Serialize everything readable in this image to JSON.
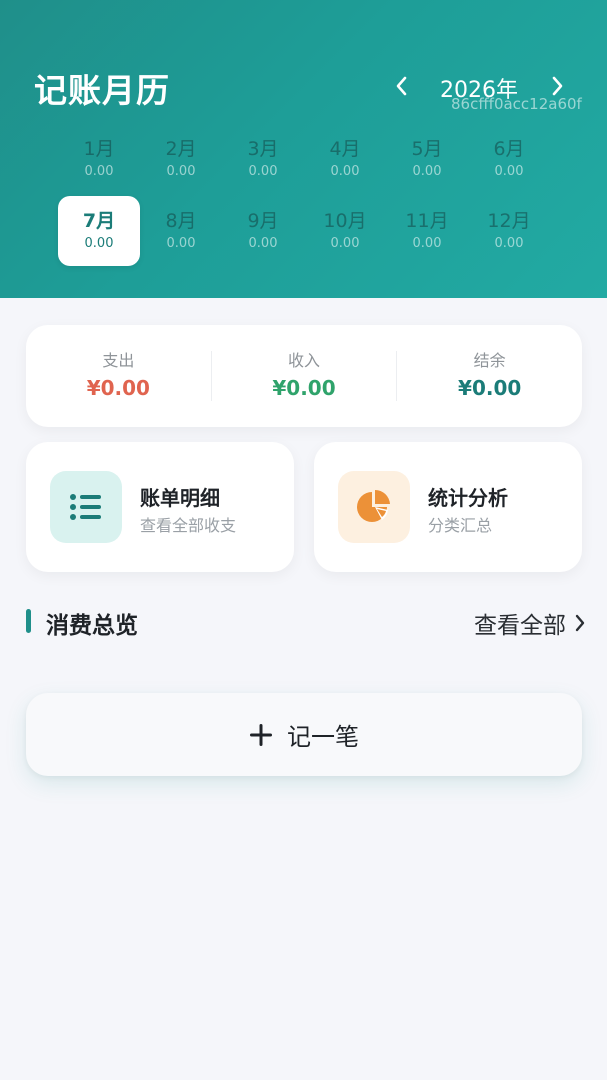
{
  "header": {
    "title": "记账月历",
    "year": "2026年",
    "hash": "86cfff0acc12a60f"
  },
  "months": [
    {
      "name": "1月",
      "amount": "0.00"
    },
    {
      "name": "2月",
      "amount": "0.00"
    },
    {
      "name": "3月",
      "amount": "0.00"
    },
    {
      "name": "4月",
      "amount": "0.00"
    },
    {
      "name": "5月",
      "amount": "0.00"
    },
    {
      "name": "6月",
      "amount": "0.00"
    },
    {
      "name": "7月",
      "amount": "0.00"
    },
    {
      "name": "8月",
      "amount": "0.00"
    },
    {
      "name": "9月",
      "amount": "0.00"
    },
    {
      "name": "10月",
      "amount": "0.00"
    },
    {
      "name": "11月",
      "amount": "0.00"
    },
    {
      "name": "12月",
      "amount": "0.00"
    }
  ],
  "selected_month": "7月",
  "summary": {
    "expense_label": "支出",
    "expense_value": "¥0.00",
    "income_label": "收入",
    "income_value": "¥0.00",
    "balance_label": "结余",
    "balance_value": "¥0.00"
  },
  "actions": {
    "bills": {
      "title": "账单明细",
      "subtitle": "查看全部收支",
      "icon": "list-icon"
    },
    "stats": {
      "title": "统计分析",
      "subtitle": "分类汇总",
      "icon": "pie-chart-icon"
    }
  },
  "section": {
    "title": "消费总览",
    "view_all": "查看全部"
  },
  "add_button": {
    "label": "记一笔",
    "icon": "plus-icon"
  },
  "colors": {
    "accent": "#1f8f8a",
    "expense": "#e0644f",
    "income": "#2fa36b",
    "balance": "#1b7c78",
    "bills_icon_bg": "#d9f2ef",
    "stats_icon_bg": "#fdf0e0",
    "stats_icon": "#ec9138"
  }
}
